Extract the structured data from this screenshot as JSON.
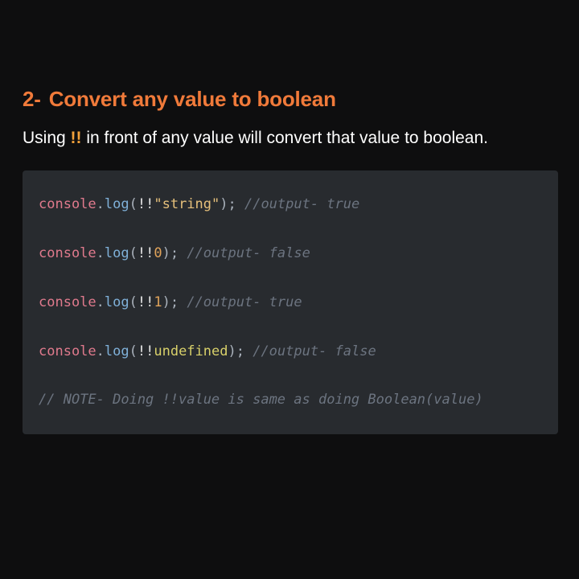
{
  "heading": {
    "number": "2-",
    "title": "Convert any value to boolean"
  },
  "intro": {
    "before": "Using ",
    "operator": "!!",
    "after": " in front of any value will convert that value to boolean."
  },
  "code": {
    "lines": [
      {
        "object": "console",
        "dot": ".",
        "method": "log",
        "open": "(",
        "operator": "!!",
        "argument": "\"string\"",
        "close": ");",
        "comment": " //output- true"
      },
      {
        "object": "console",
        "dot": ".",
        "method": "log",
        "open": "(",
        "operator": "!!",
        "argument": "0",
        "close": ");",
        "comment": " //output- false"
      },
      {
        "object": "console",
        "dot": ".",
        "method": "log",
        "open": "(",
        "operator": "!!",
        "argument": "1",
        "close": ");",
        "comment": " //output- true"
      },
      {
        "object": "console",
        "dot": ".",
        "method": "log",
        "open": "(",
        "operator": "!!",
        "argument": "undefined",
        "close": ");",
        "comment": " //output- false"
      }
    ],
    "note": "// NOTE- Doing !!value is same as doing Boolean(value)"
  },
  "colors": {
    "background": "#0e0e0f",
    "heading": "#f07a3a",
    "operator_highlight": "#f2a13a",
    "code_background": "#282b2f"
  }
}
